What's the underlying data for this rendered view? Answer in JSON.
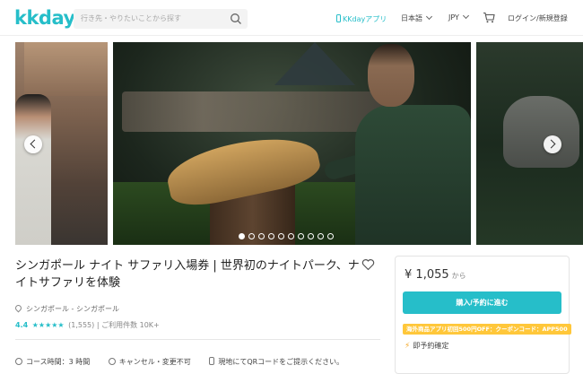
{
  "header": {
    "logo": "kkday",
    "search_placeholder": "行き先・やりたいことから探す",
    "app_link": "KKdayアプリ",
    "language": "日本語",
    "currency": "JPY",
    "login": "ログイン/新規登録"
  },
  "gallery": {
    "dot_count": 10,
    "active_index": 0
  },
  "product": {
    "title": "シンガポール ナイト サファリ入場券 | 世界初のナイトパーク、ナイトサファリを体験",
    "location": "シンガポール - シンガポール",
    "rating": "4.4",
    "stars": "★★★★★",
    "review_count": "(1,555)",
    "separator": "|",
    "booking_count": "ご利用件数 10K+",
    "features": [
      {
        "icon": "clock-icon",
        "label": "コース時間：3 時間"
      },
      {
        "icon": "cancel-icon",
        "label": "キャンセル・変更不可"
      },
      {
        "icon": "phone-icon",
        "label": "現地にてQRコードをご提示ください。"
      }
    ]
  },
  "booking": {
    "currency_symbol": "¥",
    "price": "1,055",
    "from_label": "から",
    "button_label": "購入/予約に進む",
    "promo": "海外商品アプリ初回500円OFF：クーポンコード：APP500",
    "instant_label": "即予約確定"
  },
  "colors": {
    "accent": "#26bec9",
    "promo": "#ffc73a"
  }
}
